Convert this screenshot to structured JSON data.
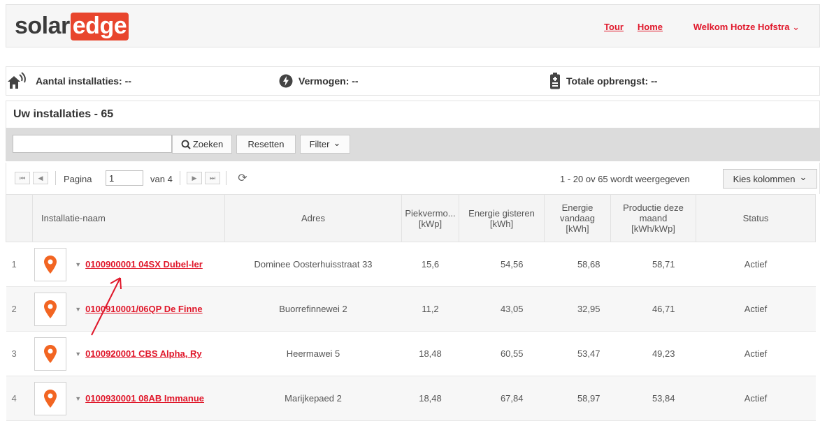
{
  "header": {
    "logo_solar": "solar",
    "logo_edge": "edge",
    "tour": "Tour",
    "home": "Home",
    "welcome": "Welkom Hotze Hofstra"
  },
  "stats": {
    "installations": "Aantal installaties: --",
    "power": "Vermogen: --",
    "yield": "Totale opbrengst: --"
  },
  "panel": {
    "title": "Uw installaties - 65"
  },
  "search": {
    "search_button": "Zoeken",
    "reset_button": "Resetten",
    "filter_button": "Filter"
  },
  "pager": {
    "page_label": "Pagina",
    "page_value": "1",
    "of_label": "van 4",
    "records": "1 - 20 ov 65 wordt weergegeven",
    "columns_button": "Kies kolommen"
  },
  "columns": {
    "name": "Installatie-naam",
    "address": "Adres",
    "peak_a": "Piekvermo...",
    "peak_b": "[kWp]",
    "yesterday_a": "Energie gisteren",
    "yesterday_b": "[kWh]",
    "today_a": "Energie",
    "today_b": "vandaag",
    "today_c": "[kWh]",
    "month_a": "Productie deze",
    "month_b": "maand",
    "month_c": "[kWh/kWp]",
    "status": "Status"
  },
  "rows": [
    {
      "num": "1",
      "name": "0100900001 04SX Dubel-ler",
      "address": "Dominee Oosterhuisstraat 33",
      "peak": "15,6",
      "yesterday": "54,56",
      "today": "58,68",
      "month": "58,71",
      "status": "Actief"
    },
    {
      "num": "2",
      "name": "0100910001/06QP De Finne",
      "address": "Buorrefinnewei 2",
      "peak": "11,2",
      "yesterday": "43,05",
      "today": "32,95",
      "month": "46,71",
      "status": "Actief"
    },
    {
      "num": "3",
      "name": "0100920001 CBS Alpha, Ry",
      "address": "Heermawei 5",
      "peak": "18,48",
      "yesterday": "60,55",
      "today": "53,47",
      "month": "49,23",
      "status": "Actief"
    },
    {
      "num": "4",
      "name": "0100930001 08AB Immanue",
      "address": "Marijkepaed 2",
      "peak": "18,48",
      "yesterday": "67,84",
      "today": "58,97",
      "month": "53,84",
      "status": "Actief"
    }
  ],
  "colors": {
    "brand_red": "#e0182b",
    "logo_orange": "#e8452d",
    "pin_orange": "#f26522"
  }
}
